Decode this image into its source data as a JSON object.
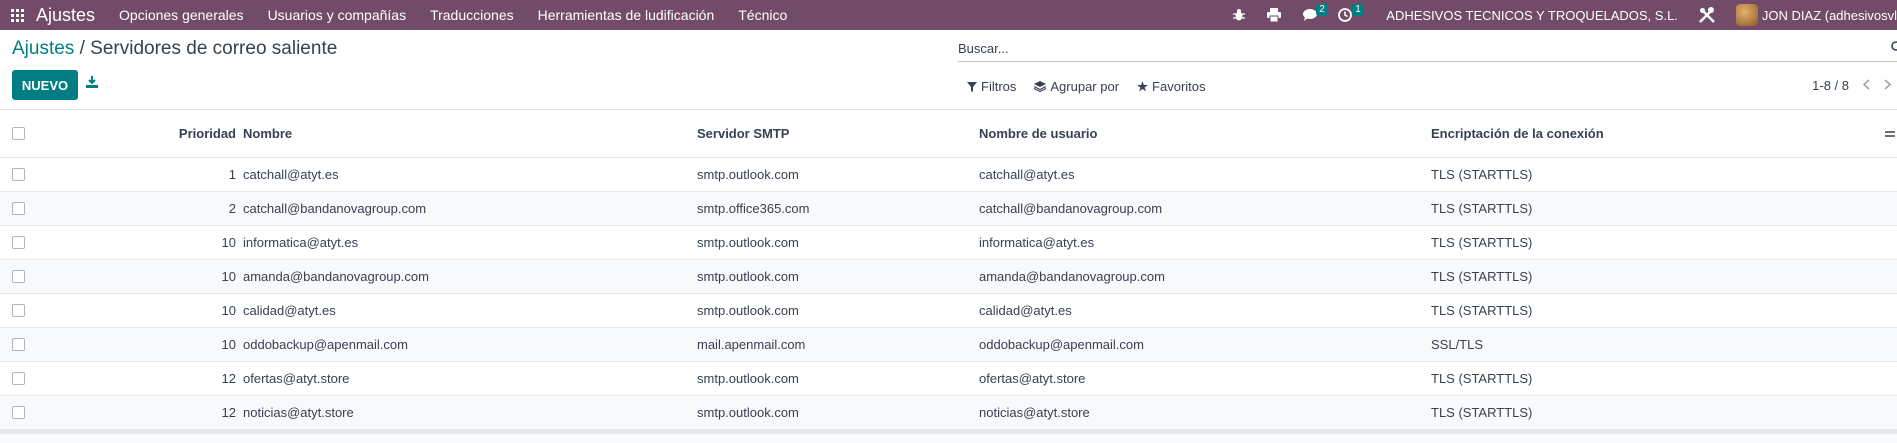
{
  "navbar": {
    "brand": "Ajustes",
    "menu": [
      "Opciones generales",
      "Usuarios y compañías",
      "Traducciones",
      "Herramientas de ludificación",
      "Técnico"
    ],
    "messages_count": "2",
    "activities_count": "1",
    "company": "ADHESIVOS TECNICOS Y TROQUELADOS, S.L.",
    "user": "JON DIAZ (adhesivosvl"
  },
  "breadcrumb": {
    "root": "Ajustes",
    "separator": "/",
    "current": "Servidores de correo saliente"
  },
  "toolbar": {
    "new_label": "NUEVO"
  },
  "search": {
    "placeholder": "Buscar..."
  },
  "filters": {
    "filters_label": "Filtros",
    "group_label": "Agrupar por",
    "fav_label": "Favoritos"
  },
  "pager": {
    "text": "1-8 / 8"
  },
  "columns": {
    "priority": "Prioridad",
    "name": "Nombre",
    "smtp": "Servidor SMTP",
    "username": "Nombre de usuario",
    "encryption": "Encriptación de la conexión"
  },
  "rows": [
    {
      "priority": "1",
      "name": "catchall@atyt.es",
      "smtp": "smtp.outlook.com",
      "username": "catchall@atyt.es",
      "encryption": "TLS (STARTTLS)"
    },
    {
      "priority": "2",
      "name": "catchall@bandanovagroup.com",
      "smtp": "smtp.office365.com",
      "username": "catchall@bandanovagroup.com",
      "encryption": "TLS (STARTTLS)"
    },
    {
      "priority": "10",
      "name": "informatica@atyt.es",
      "smtp": "smtp.outlook.com",
      "username": "informatica@atyt.es",
      "encryption": "TLS (STARTTLS)"
    },
    {
      "priority": "10",
      "name": "amanda@bandanovagroup.com",
      "smtp": "smtp.outlook.com",
      "username": "amanda@bandanovagroup.com",
      "encryption": "TLS (STARTTLS)"
    },
    {
      "priority": "10",
      "name": "calidad@atyt.es",
      "smtp": "smtp.outlook.com",
      "username": "calidad@atyt.es",
      "encryption": "TLS (STARTTLS)"
    },
    {
      "priority": "10",
      "name": "oddobackup@apenmail.com",
      "smtp": "mail.apenmail.com",
      "username": "oddobackup@apenmail.com",
      "encryption": "SSL/TLS"
    },
    {
      "priority": "12",
      "name": "ofertas@atyt.store",
      "smtp": "smtp.outlook.com",
      "username": "ofertas@atyt.store",
      "encryption": "TLS (STARTTLS)"
    },
    {
      "priority": "12",
      "name": "noticias@atyt.store",
      "smtp": "smtp.outlook.com",
      "username": "noticias@atyt.store",
      "encryption": "TLS (STARTTLS)"
    }
  ],
  "colors": {
    "navbar": "#714b67",
    "primary": "#017e84"
  }
}
